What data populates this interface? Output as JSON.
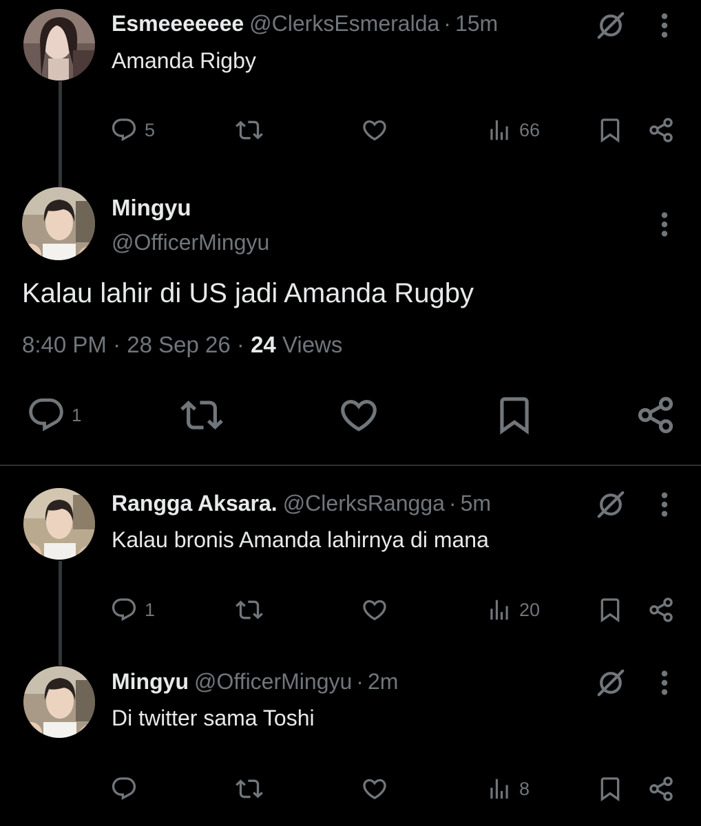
{
  "replies_above": [
    {
      "display_name": "Esmeeeeeee",
      "handle": "@ClerksEsmeralda",
      "separator": "·",
      "time": "15m",
      "text": "Amanda Rigby",
      "reply_count": "5",
      "view_count": "66"
    }
  ],
  "main_tweet": {
    "display_name": "Mingyu",
    "handle": "@OfficerMingyu",
    "text": "Kalau lahir di US jadi Amanda Rugby",
    "time": "8:40 PM",
    "sep1": "·",
    "date": "28 Sep 26",
    "sep2": "·",
    "views_count": "24",
    "views_label": "Views",
    "reply_count": "1"
  },
  "replies_below": [
    {
      "display_name": "Rangga Aksara.",
      "handle": "@ClerksRangga",
      "separator": "·",
      "time": "5m",
      "text": "Kalau bronis Amanda lahirnya di mana",
      "reply_count": "1",
      "view_count": "20"
    },
    {
      "display_name": "Mingyu",
      "handle": "@OfficerMingyu",
      "separator": "·",
      "time": "2m",
      "text": "Di twitter sama Toshi",
      "reply_count": "",
      "view_count": "8"
    }
  ],
  "colors": {
    "background": "#000000",
    "text_primary": "#e7e9ea",
    "text_secondary": "#71767b",
    "divider": "#2f3336",
    "thread_line": "#333639"
  },
  "icons": [
    "reply-icon",
    "retweet-icon",
    "like-icon",
    "views-icon",
    "bookmark-icon",
    "share-icon",
    "grok-icon",
    "more-icon"
  ]
}
